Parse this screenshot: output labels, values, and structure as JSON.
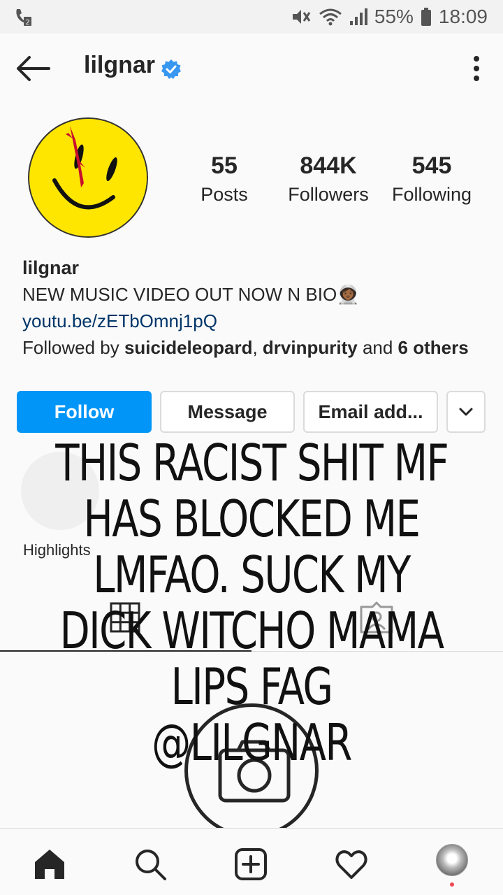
{
  "status_bar": {
    "battery": "55%",
    "time": "18:09",
    "icons": [
      "call-sim2-icon",
      "mute-icon",
      "wifi-icon",
      "signal-icon",
      "battery-icon"
    ]
  },
  "header": {
    "title": "lilgnar",
    "verified": true,
    "back_icon": "arrow-left-icon",
    "more_icon": "vertical-dots-icon"
  },
  "profile": {
    "stats": [
      {
        "value": "55",
        "label": "Posts"
      },
      {
        "value": "844K",
        "label": "Followers"
      },
      {
        "value": "545",
        "label": "Following"
      }
    ],
    "name": "lilgnar",
    "bio_text": "NEW MUSIC VIDEO OUT NOW N BIO",
    "bio_emoji": "👩🏾‍🚀",
    "link": "youtu.be/zETbOmnj1pQ",
    "followed_by_prefix": "Followed by ",
    "followed_by_user1": "suicideleopard",
    "followed_by_sep": ", ",
    "followed_by_user2": "drvinpurity",
    "followed_by_and": " and ",
    "followed_by_others": "6 others"
  },
  "buttons": {
    "follow": "Follow",
    "message": "Message",
    "email": "Email add...",
    "more_icon": "chevron-down-icon"
  },
  "highlights": {
    "label": "Highlights"
  },
  "overlay_text": [
    "THIS RACIST SHIT MF",
    "HAS BLOCKED ME",
    "LMFAO.  SUCK MY",
    "DICK WITCHO MAMA",
    "LIPS FAG",
    "@LILGNAR"
  ],
  "bottom_nav": [
    "home-icon",
    "search-icon",
    "add-post-icon",
    "heart-icon",
    "profile-avatar"
  ],
  "colors": {
    "follow_button": "#0095f6",
    "verified_badge": "#3897f0",
    "link": "#003569",
    "avatar_yellow": "#ffe600",
    "notification_dot": "#ed4956"
  }
}
